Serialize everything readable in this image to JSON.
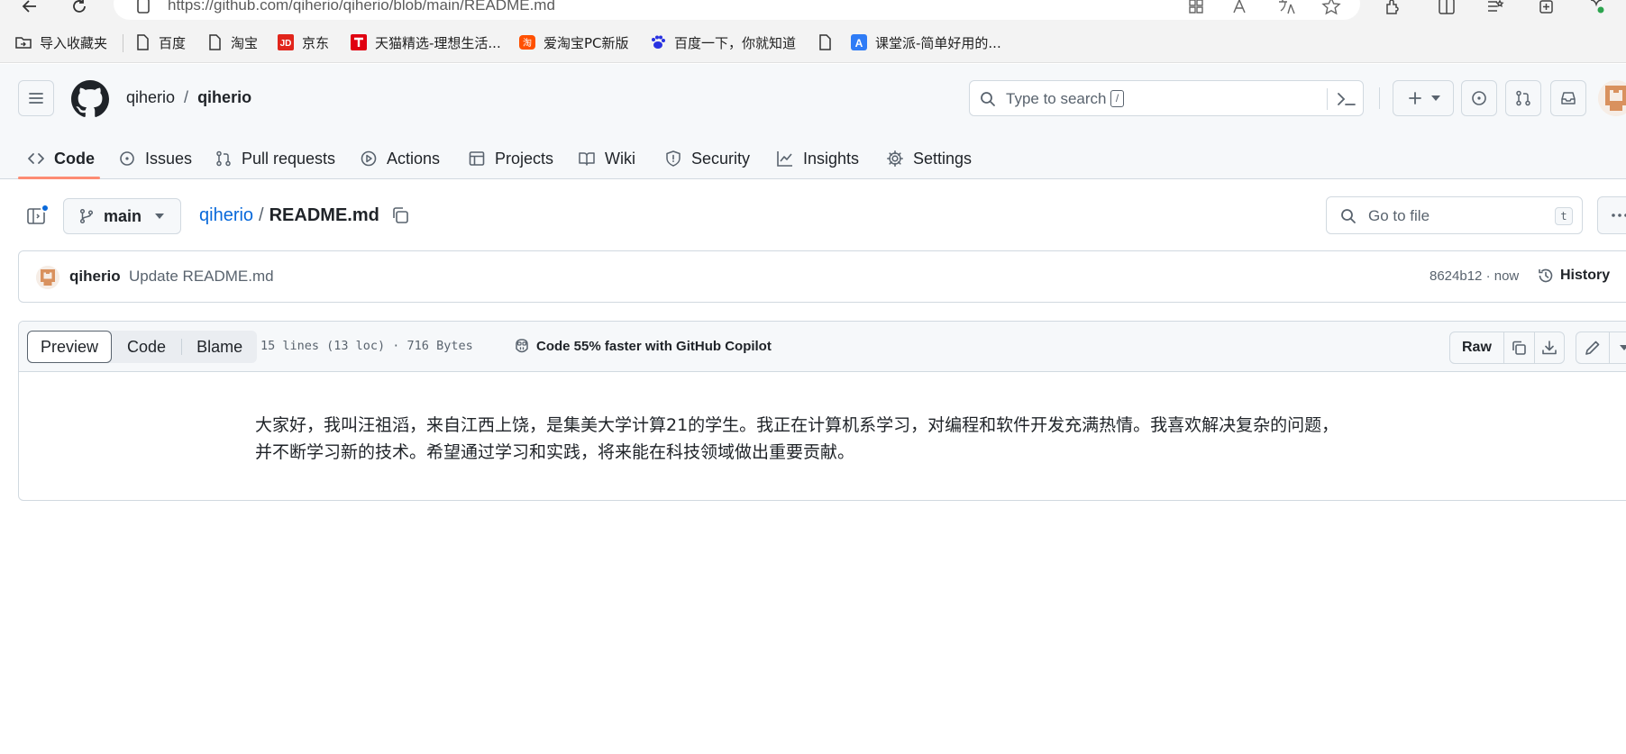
{
  "browser": {
    "url": "https://github.com/qiherio/qiherio/blob/main/README.md",
    "bookmarks": [
      {
        "label": "导入收藏夹",
        "icon": "import-folder-icon"
      },
      {
        "label": "百度",
        "icon": "page-icon"
      },
      {
        "label": "淘宝",
        "icon": "page-icon"
      },
      {
        "label": "京东",
        "icon": "jd-logo-icon"
      },
      {
        "label": "天猫精选-理想生活...",
        "icon": "tmall-logo-icon"
      },
      {
        "label": "爱淘宝PC新版",
        "icon": "aitaobao-logo-icon"
      },
      {
        "label": "百度一下，你就知道",
        "icon": "baidu-paw-icon"
      },
      {
        "label": "",
        "icon": "page-icon"
      },
      {
        "label": "课堂派-简单好用的...",
        "icon": "ketangpai-logo-icon"
      }
    ]
  },
  "header": {
    "owner": "qiherio",
    "separator": "/",
    "repo": "qiherio",
    "search_placeholder": "Type to search",
    "search_kbd": "/"
  },
  "nav": {
    "tabs": [
      {
        "label": "Code",
        "icon": "code-icon",
        "active": true
      },
      {
        "label": "Issues",
        "icon": "issue-opened-icon"
      },
      {
        "label": "Pull requests",
        "icon": "git-pull-request-icon"
      },
      {
        "label": "Actions",
        "icon": "play-icon"
      },
      {
        "label": "Projects",
        "icon": "table-icon"
      },
      {
        "label": "Wiki",
        "icon": "book-icon"
      },
      {
        "label": "Security",
        "icon": "shield-icon"
      },
      {
        "label": "Insights",
        "icon": "graph-icon"
      },
      {
        "label": "Settings",
        "icon": "gear-icon"
      }
    ]
  },
  "file": {
    "branch": "main",
    "breadcrumb_repo": "qiherio",
    "breadcrumb_sep": "/",
    "filename": "README.md",
    "goto_placeholder": "Go to file",
    "goto_kbd": "t"
  },
  "commit": {
    "author": "qiherio",
    "message": "Update README.md",
    "meta": "8624b12 · now",
    "history_label": "History"
  },
  "viewer": {
    "modes": [
      "Preview",
      "Code",
      "Blame"
    ],
    "stats": "15 lines (13 loc) · 716 Bytes",
    "copilot": "Code 55% faster with GitHub Copilot",
    "raw_label": "Raw",
    "content_line1": "大家好，我叫汪祖滔，来自江西上饶，是集美大学计算21的学生。我正在计算机系学习，对编程和软件开发充满热情。我喜欢解决复杂的问题，",
    "content_line2": "并不断学习新的技术。希望通过学习和实践，将来能在科技领域做出重要贡献。"
  },
  "colors": {
    "accent_blue": "#0969da",
    "tab_underline": "#fd8c73",
    "text_primary": "#1f2328",
    "text_muted": "#59636e",
    "border": "#d1d9e0"
  }
}
